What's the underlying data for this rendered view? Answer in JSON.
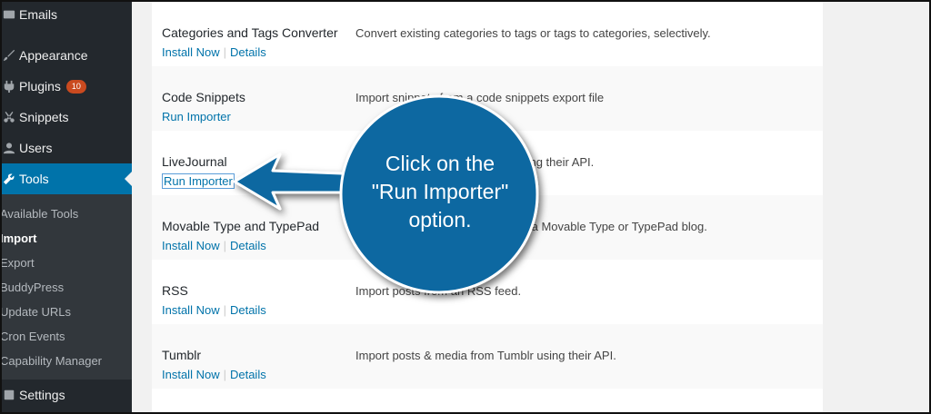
{
  "sidebar": {
    "menu": [
      {
        "label": "Emails",
        "icon": "email-icon"
      },
      {
        "label": "Appearance",
        "icon": "paintbrush-icon"
      },
      {
        "label": "Plugins",
        "icon": "plugin-icon",
        "badge": "10"
      },
      {
        "label": "Snippets",
        "icon": "scissors-icon"
      },
      {
        "label": "Users",
        "icon": "user-icon"
      },
      {
        "label": "Tools",
        "icon": "wrench-icon"
      },
      {
        "label": "Settings",
        "icon": "settings-icon"
      }
    ],
    "submenu": [
      "Available Tools",
      "Import",
      "Export",
      "BuddyPress",
      "Update URLs",
      "Cron Events",
      "Capability Manager"
    ]
  },
  "importers": [
    {
      "name": "Categories and Tags Converter",
      "action": "Install Now",
      "details": "Details",
      "description": "Convert existing categories to tags or tags to categories, selectively."
    },
    {
      "name": "Code Snippets",
      "action": "Run Importer",
      "description": "Import snippets from a code snippets export file"
    },
    {
      "name": "LiveJournal",
      "action": "Run Importer",
      "description": "Import posts from LiveJournal using their API."
    },
    {
      "name": "Movable Type and TypePad",
      "action": "Install Now",
      "details": "Details",
      "description": "Import posts and comments from a Movable Type or TypePad blog."
    },
    {
      "name": "RSS",
      "action": "Install Now",
      "details": "Details",
      "description": "Import posts from an RSS feed."
    },
    {
      "name": "Tumblr",
      "action": "Install Now",
      "details": "Details",
      "description": "Import posts & media from Tumblr using their API."
    }
  ],
  "callout": {
    "lines": [
      "Click on the",
      "\"Run Importer\"",
      "option."
    ],
    "color": "#0f67a1"
  },
  "colors": {
    "sidebar_bg": "#23282d",
    "active_bg": "#0073aa",
    "link": "#0073aa",
    "badge": "#ca4a1f"
  }
}
